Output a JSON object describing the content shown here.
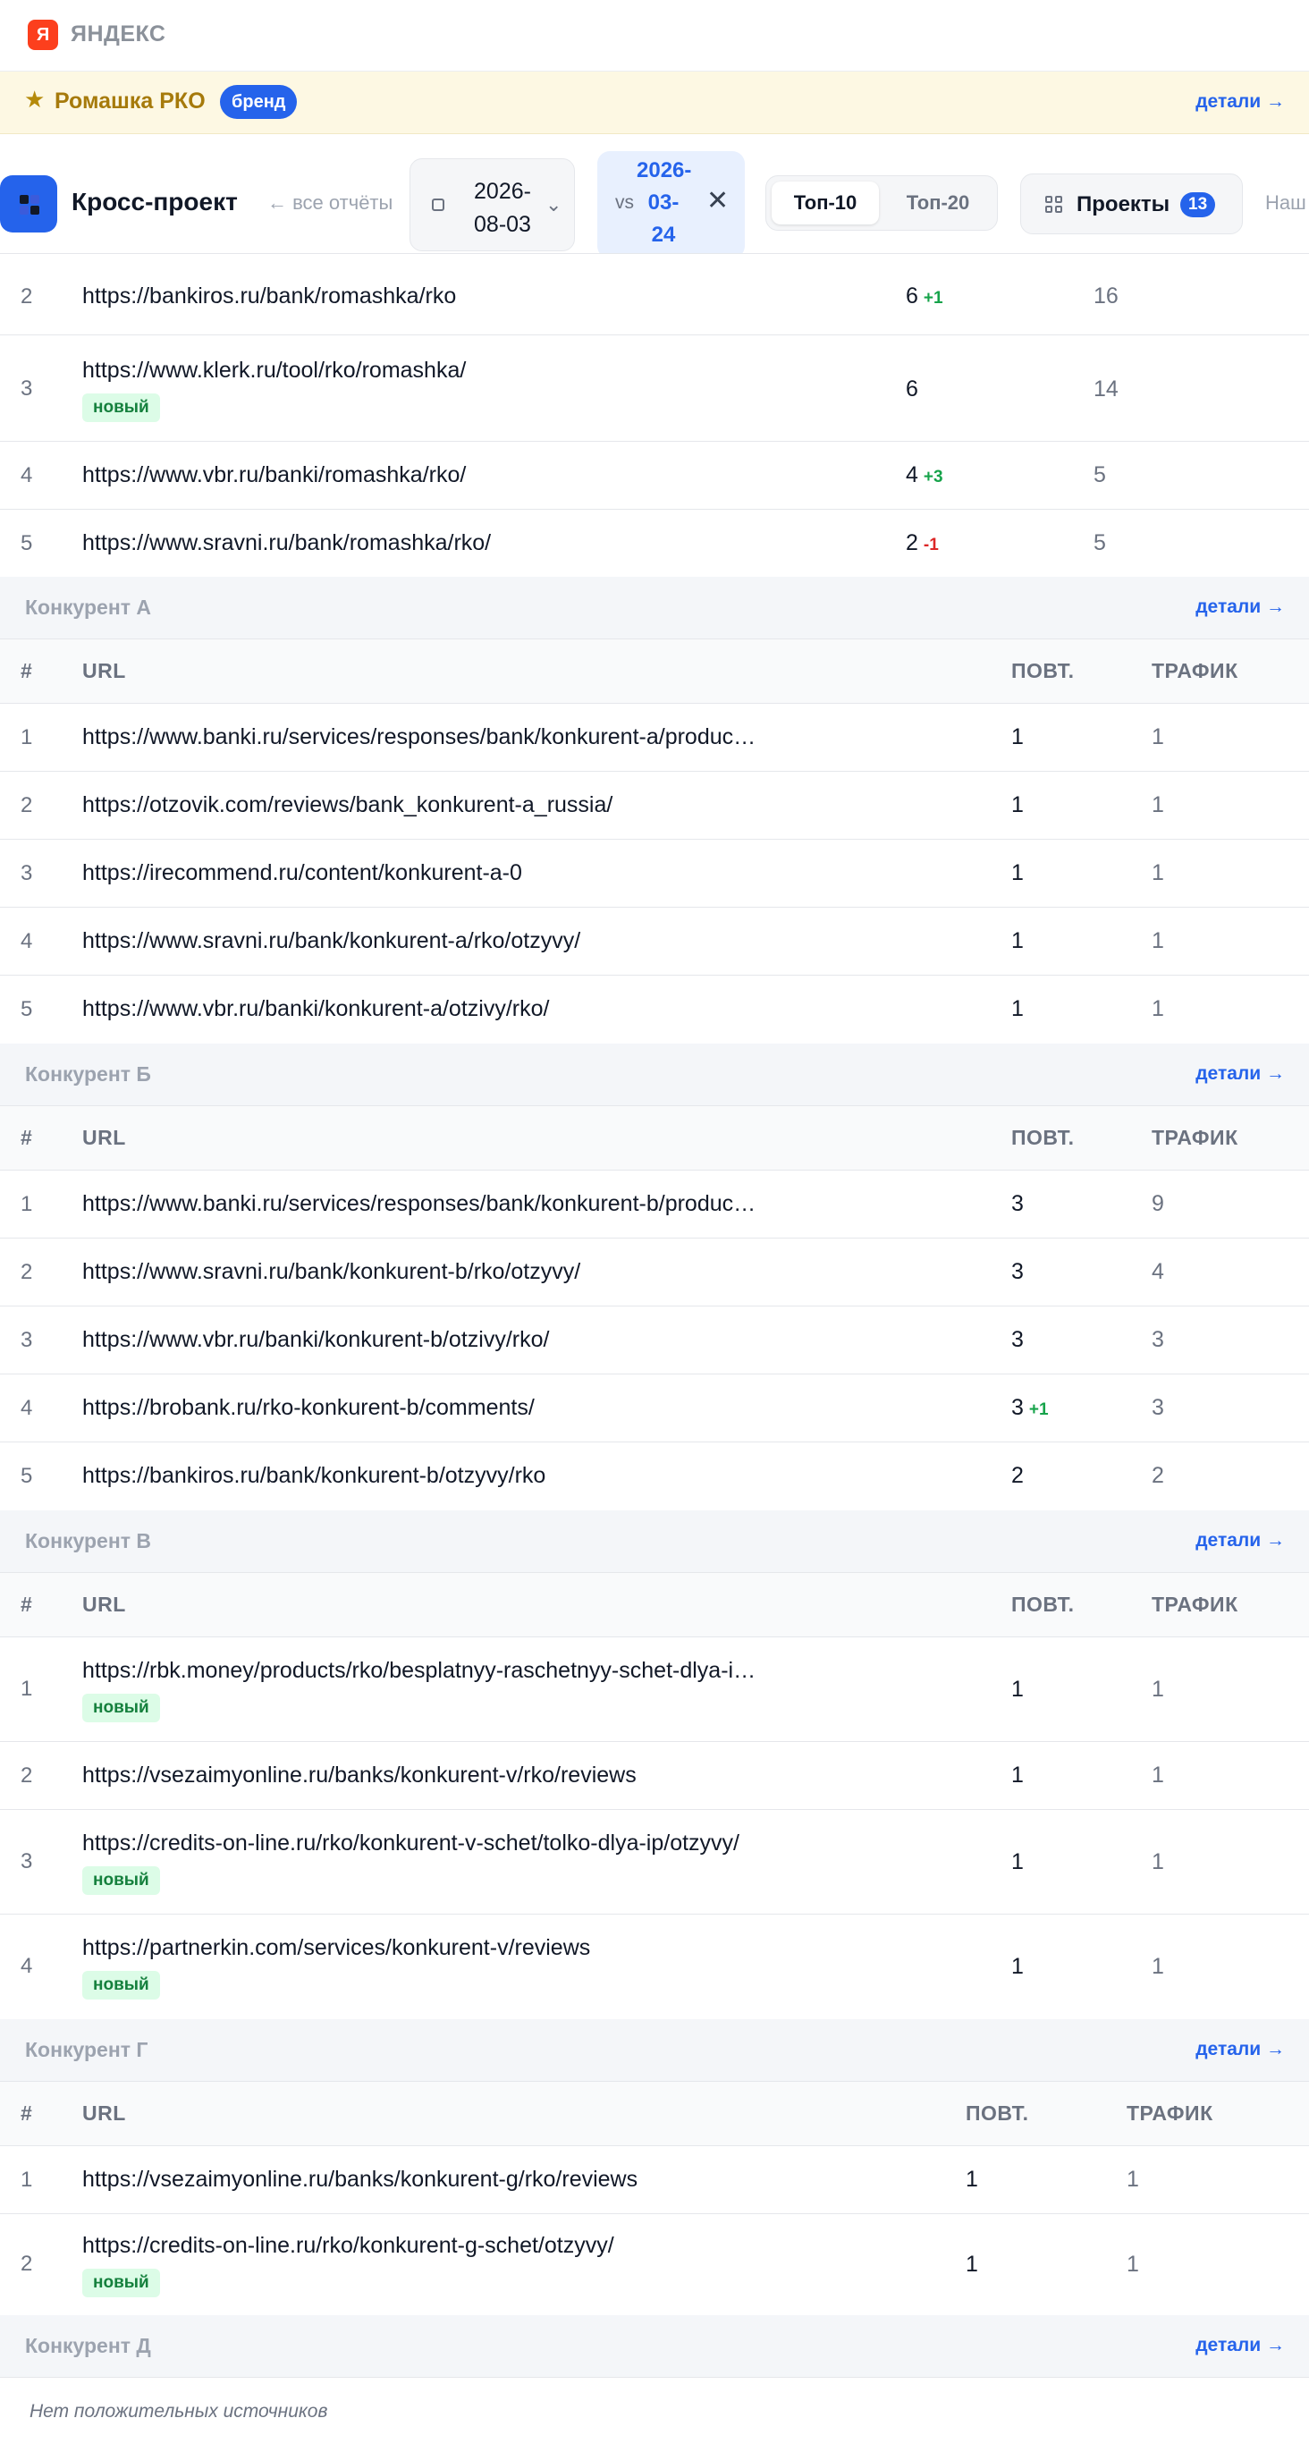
{
  "engine": {
    "logo_letter": "Я",
    "name": "ЯНДЕКС",
    "logo_color": "#fc3f1d"
  },
  "brand": {
    "name": "Ромашка РКО",
    "badge": "бренд",
    "details": "детали →"
  },
  "toolbar": {
    "title": "Кросс-проект",
    "back": "← все отчёты",
    "date": {
      "line1": "2026-",
      "line2": "08-03"
    },
    "compare": {
      "prefix": "vs",
      "line1": "2026-",
      "line2": "03-",
      "line3": "24"
    },
    "top_options": [
      "Топ-10",
      "Топ-20"
    ],
    "top_selected": "Топ-10",
    "projects_label": "Проекты",
    "projects_count": "13",
    "overflow_tab": "Наш"
  },
  "brand_rows": [
    {
      "num": "2",
      "url": "https://bankiros.ru/bank/romashka/rko",
      "reps": "6",
      "delta": "+1",
      "traffic": "16"
    },
    {
      "num": "3",
      "url": "https://www.klerk.ru/tool/rko/romashka/",
      "reps": "6",
      "delta": "",
      "traffic": "14",
      "badge": "новый"
    },
    {
      "num": "4",
      "url": "https://www.vbr.ru/banki/romashka/rko/",
      "reps": "4",
      "delta": "+3",
      "traffic": "5"
    },
    {
      "num": "5",
      "url": "https://www.sravni.ru/bank/romashka/rko/",
      "reps": "2",
      "delta": "-1",
      "traffic": "5"
    }
  ],
  "columns": {
    "num": "#",
    "url": "URL",
    "reps": "ПОВТ.",
    "traffic": "ТРАФИК"
  },
  "details_label": "детали →",
  "groups": [
    {
      "name": "Конкурент А",
      "rows": [
        {
          "num": "1",
          "url": "https://www.banki.ru/services/responses/bank/konkurent-a/produc…",
          "reps": "1",
          "traffic": "1"
        },
        {
          "num": "2",
          "url": "https://otzovik.com/reviews/bank_konkurent-a_russia/",
          "reps": "1",
          "traffic": "1"
        },
        {
          "num": "3",
          "url": "https://irecommend.ru/content/konkurent-a-0",
          "reps": "1",
          "traffic": "1"
        },
        {
          "num": "4",
          "url": "https://www.sravni.ru/bank/konkurent-a/rko/otzyvy/",
          "reps": "1",
          "traffic": "1"
        },
        {
          "num": "5",
          "url": "https://www.vbr.ru/banki/konkurent-a/otzivy/rko/",
          "reps": "1",
          "traffic": "1"
        }
      ]
    },
    {
      "name": "Конкурент Б",
      "rows": [
        {
          "num": "1",
          "url": "https://www.banki.ru/services/responses/bank/konkurent-b/produc…",
          "reps": "3",
          "traffic": "9"
        },
        {
          "num": "2",
          "url": "https://www.sravni.ru/bank/konkurent-b/rko/otzyvy/",
          "reps": "3",
          "traffic": "4"
        },
        {
          "num": "3",
          "url": "https://www.vbr.ru/banki/konkurent-b/otzivy/rko/",
          "reps": "3",
          "traffic": "3"
        },
        {
          "num": "4",
          "url": "https://brobank.ru/rko-konkurent-b/comments/",
          "reps": "3",
          "delta": "+1",
          "traffic": "3"
        },
        {
          "num": "5",
          "url": "https://bankiros.ru/bank/konkurent-b/otzyvy/rko",
          "reps": "2",
          "traffic": "2"
        }
      ]
    },
    {
      "name": "Конкурент В",
      "rows": [
        {
          "num": "1",
          "url": "https://rbk.money/products/rko/besplatnyy-raschetnyy-schet-dlya-i…",
          "reps": "1",
          "traffic": "1",
          "badge": "новый"
        },
        {
          "num": "2",
          "url": "https://vsezaimyonline.ru/banks/konkurent-v/rko/reviews",
          "reps": "1",
          "traffic": "1"
        },
        {
          "num": "3",
          "url": "https://credits-on-line.ru/rko/konkurent-v-schet/tolko-dlya-ip/otzyvy/",
          "reps": "1",
          "traffic": "1",
          "badge": "новый"
        },
        {
          "num": "4",
          "url": "https://partnerkin.com/services/konkurent-v/reviews",
          "reps": "1",
          "traffic": "1",
          "badge": "новый"
        }
      ]
    },
    {
      "name": "Конкурент Г",
      "rows": [
        {
          "num": "1",
          "url": "https://vsezaimyonline.ru/banks/konkurent-g/rko/reviews",
          "reps": "1",
          "traffic": "1"
        },
        {
          "num": "2",
          "url": "https://credits-on-line.ru/rko/konkurent-g-schet/otzyvy/",
          "reps": "1",
          "traffic": "1",
          "badge": "новый"
        }
      ]
    },
    {
      "name": "Конкурент Д",
      "empty": "Нет положительных источников"
    }
  ]
}
